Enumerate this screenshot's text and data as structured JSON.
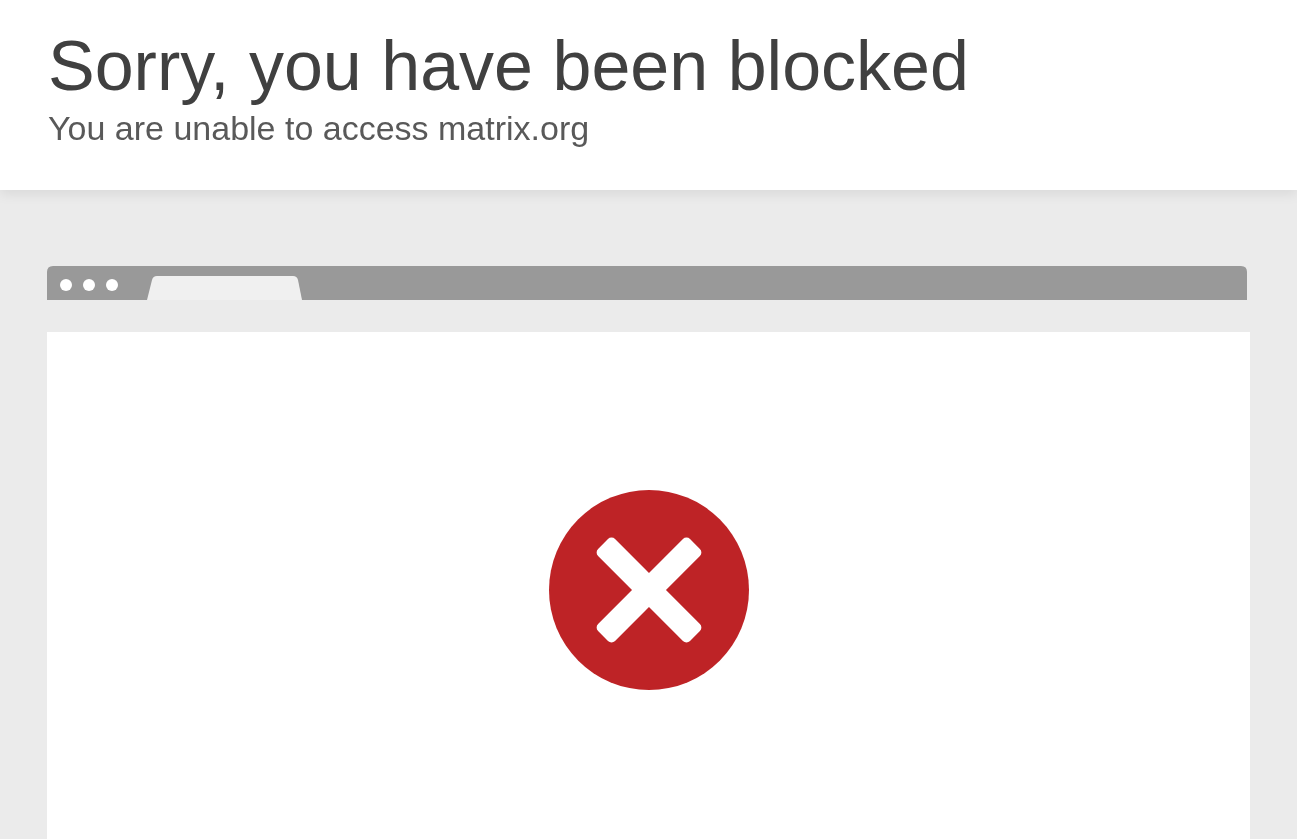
{
  "header": {
    "title": "Sorry, you have been blocked",
    "subtitle": "You are unable to access matrix.org"
  }
}
